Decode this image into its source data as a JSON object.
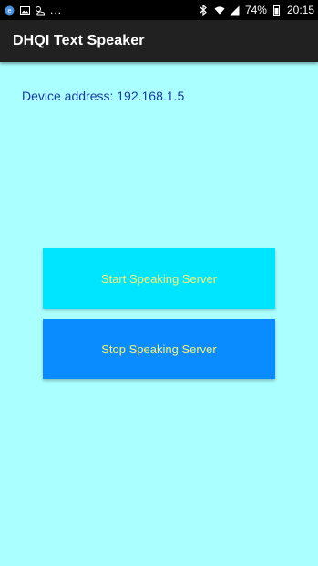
{
  "status_bar": {
    "left_icons": [
      "app-notification-icon",
      "image-icon",
      "weather-icon"
    ],
    "more_indicator": "...",
    "right_icons": [
      "bluetooth-icon",
      "wifi-icon",
      "signal-icon"
    ],
    "battery_percent": "74%",
    "time": "20:15"
  },
  "app_bar": {
    "title": "DHQI Text Speaker"
  },
  "main": {
    "device_address": "Device address: 192.168.1.5",
    "start_button_label": "Start Speaking Server",
    "stop_button_label": "Stop Speaking Server"
  },
  "colors": {
    "background": "#aaffff",
    "app_bar": "#212121",
    "start_button": "#00e5ff",
    "stop_button": "#0a8cff",
    "button_text": "#f5ef7a",
    "address_text": "#1a3a9a"
  }
}
